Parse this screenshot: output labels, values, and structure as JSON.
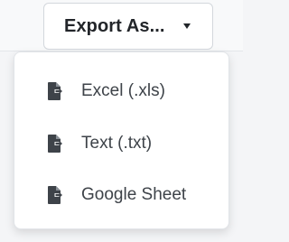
{
  "export_button": {
    "label": "Export As...",
    "caret_icon": "caret-down-icon"
  },
  "menu": {
    "items": [
      {
        "label": "Excel (.xls)",
        "icon": "file-export-icon"
      },
      {
        "label": "Text (.txt)",
        "icon": "file-export-icon"
      },
      {
        "label": "Google Sheet",
        "icon": "file-export-icon"
      }
    ]
  },
  "colors": {
    "text_dark": "#222529",
    "menu_text": "#3e4349",
    "icon": "#3e4349",
    "border": "#d3d7dc",
    "menu_bg": "#ffffff"
  }
}
